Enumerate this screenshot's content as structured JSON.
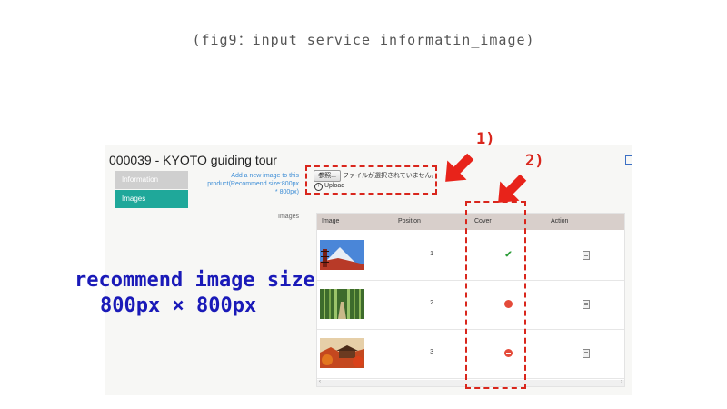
{
  "caption": "(fig9：input service informatin_image)",
  "page": {
    "title": "000039 - KYOTO guiding tour",
    "tabs": [
      {
        "label": "Information",
        "active": false
      },
      {
        "label": "Images",
        "active": true
      }
    ]
  },
  "upload": {
    "hint": "Add a new image to this product(Recommend size:800px * 800px)",
    "browse_label": "参照...",
    "file_status": "ファイルが選択されていません。",
    "upload_label": "Upload",
    "field_label": "Images"
  },
  "grid": {
    "columns": [
      "Image",
      "Position",
      "Cover",
      "Action"
    ],
    "rows": [
      {
        "thumbnail_icon": "image-thumbnail-fuji-pagoda",
        "position": "1",
        "cover": true,
        "action_icon": "delete-icon"
      },
      {
        "thumbnail_icon": "image-thumbnail-bamboo-grove",
        "position": "2",
        "cover": false,
        "action_icon": "delete-icon"
      },
      {
        "thumbnail_icon": "image-thumbnail-autumn-temple",
        "position": "3",
        "cover": false,
        "action_icon": "delete-icon"
      }
    ]
  },
  "annotations": {
    "marker_1": "1)",
    "marker_2": "2)",
    "note_line1": "recommend image size",
    "note_line2": "800px × 800px"
  },
  "colors": {
    "accent_teal": "#1fa89a",
    "annotation_red": "#d9261c",
    "note_blue": "#1a1ab8",
    "grid_header": "#d8cfcb"
  }
}
